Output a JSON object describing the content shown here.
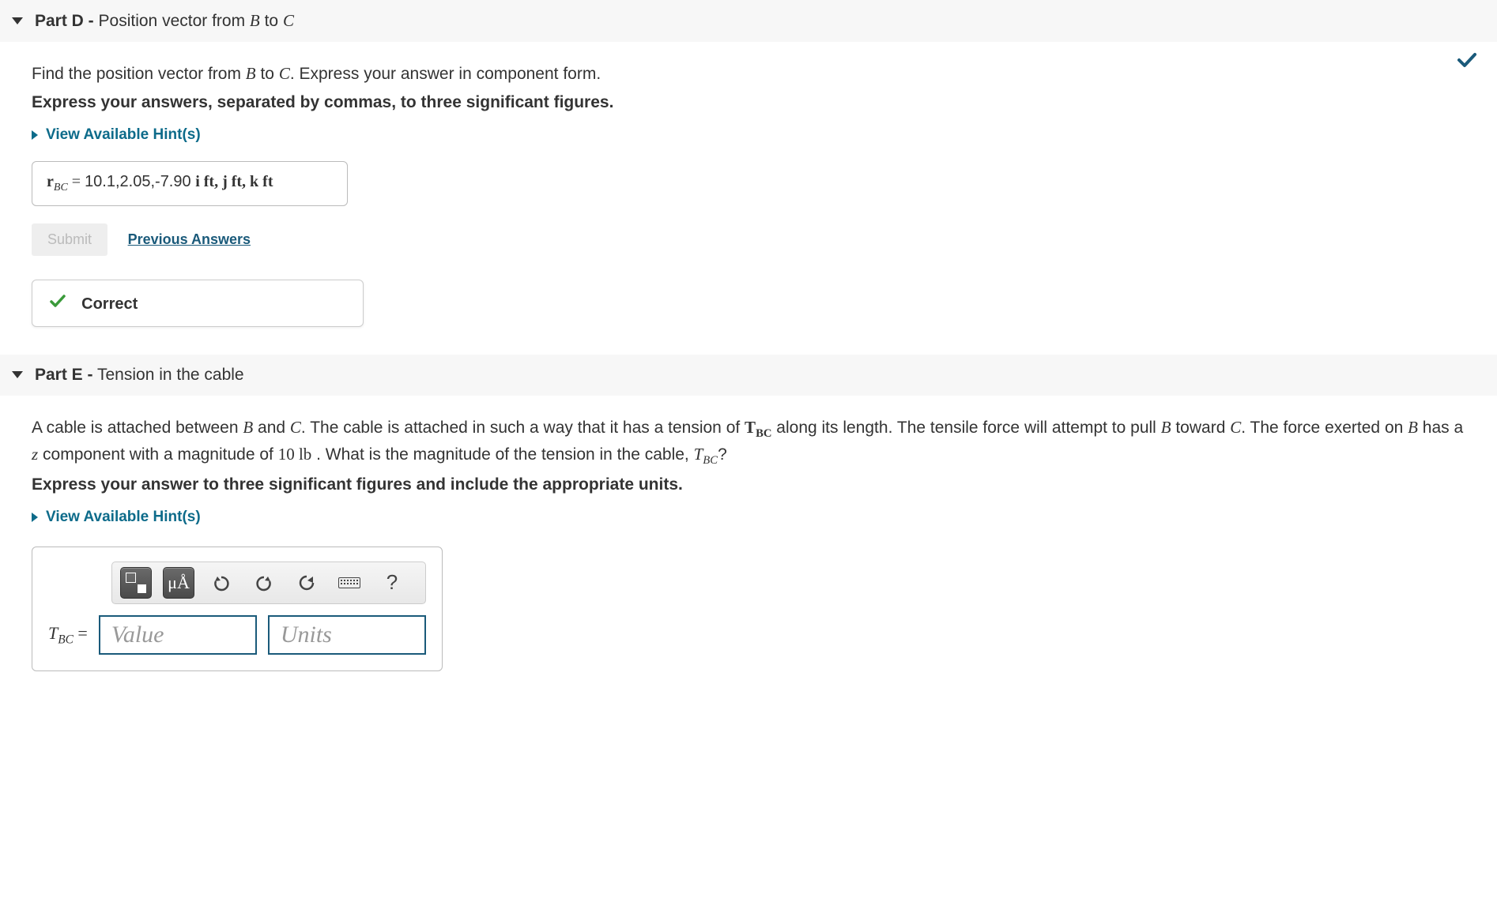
{
  "partD": {
    "header_bold": "Part D -",
    "header_rest": " Position vector from ",
    "header_B": "B",
    "header_to": " to ",
    "header_C": "C",
    "prompt_pre": "Find the position vector from ",
    "prompt_B": "B",
    "prompt_mid": " to ",
    "prompt_C": "C",
    "prompt_post": ". Express your answer in component form.",
    "instruct": "Express your answers, separated by commas, to three significant figures.",
    "hints": "View Available Hint(s)",
    "answer_lhs": "r",
    "answer_sub": "BC",
    "answer_eq": " = ",
    "answer_val": "10.1,2.05,-7.90",
    "answer_units": "  i ft, j ft, k ft",
    "submit": "Submit",
    "prev": "Previous Answers",
    "correct": "Correct"
  },
  "partE": {
    "header_bold": "Part E -",
    "header_rest": " Tension in the cable",
    "p1a": "A cable is attached between ",
    "p1B": "B",
    "p1b": " and ",
    "p1C": "C",
    "p1c": ". The cable is attached in such a way that it has a tension of ",
    "p1T": "T",
    "p1Tsub": "BC",
    "p1d": " along its length. The tensile force will attempt to pull ",
    "p1B2": "B",
    "p1e": " toward ",
    "p1C2": "C",
    "p1f": ". The force exerted on ",
    "p1B3": "B",
    "p1g": " has a ",
    "p1z": "z",
    "p1h": " component with a magnitude of ",
    "p1ten": "10 lb",
    "p1i": " . What is the magnitude of the tension in the cable, ",
    "p1T2": "T",
    "p1T2sub": "BC",
    "p1j": "?",
    "instruct": "Express your answer to three significant figures and include the appropriate units.",
    "hints": "View Available Hint(s)",
    "mua": "μÅ",
    "qmark": "?",
    "lhs_T": "T",
    "lhs_sub": "BC",
    "lhs_eq": " =",
    "value_ph": "Value",
    "units_ph": "Units"
  }
}
